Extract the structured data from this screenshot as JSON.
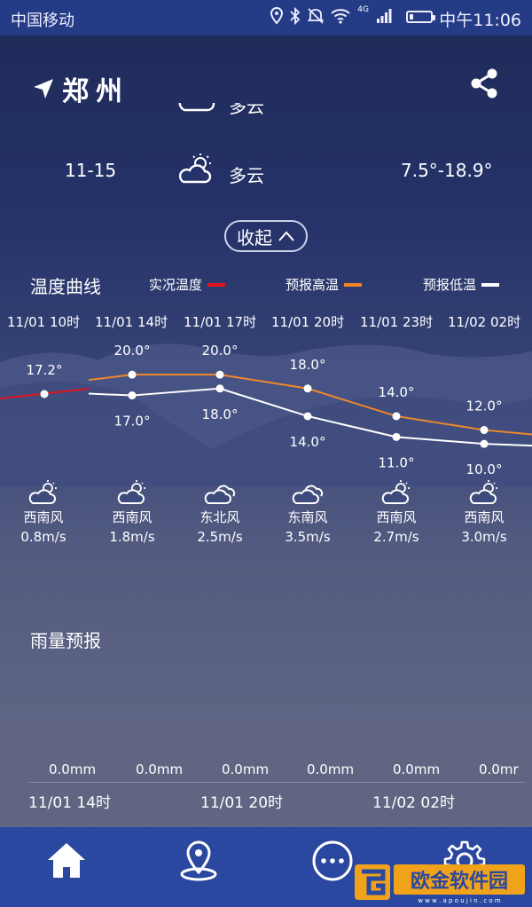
{
  "status_bar": {
    "carrier": "中国移动",
    "time": "中午11:06",
    "network": "4G",
    "icons": [
      "location-icon",
      "bluetooth-icon",
      "mute-icon",
      "wifi-icon",
      "signal-icon",
      "battery-icon"
    ],
    "battery_level": 0.2
  },
  "header": {
    "city": "郑州",
    "location_icon": "location-arrow-icon",
    "share_icon": "share-icon"
  },
  "daily": [
    {
      "date": "",
      "desc": "多云",
      "temp": "",
      "icon": "partly-cloudy-icon"
    },
    {
      "date": "11-15",
      "desc": "多云",
      "temp": "7.5°-18.9°",
      "icon": "partly-cloudy-icon"
    }
  ],
  "collapse_button": {
    "label": "收起",
    "icon": "chevron-up-icon"
  },
  "temp_section": {
    "title": "温度曲线",
    "legend": [
      {
        "label": "实况温度",
        "color": "#e0141e"
      },
      {
        "label": "预报高温",
        "color": "#f0882a"
      },
      {
        "label": "预报低温",
        "color": "#ffffff"
      }
    ]
  },
  "chart_data": {
    "type": "line",
    "x": [
      "11/01 10时",
      "11/01 14时",
      "11/01 17时",
      "11/01 20时",
      "11/01 23时",
      "11/02 02时"
    ],
    "series": [
      {
        "name": "实况温度",
        "values": [
          17.2,
          null,
          null,
          null,
          null,
          null
        ]
      },
      {
        "name": "预报高温",
        "values": [
          null,
          20.0,
          20.0,
          18.0,
          14.0,
          12.0
        ]
      },
      {
        "name": "预报低温",
        "values": [
          null,
          17.0,
          18.0,
          14.0,
          11.0,
          10.0
        ]
      }
    ],
    "labels": {
      "observed": [
        "17.2°"
      ],
      "high": [
        "20.0°",
        "20.0°",
        "18.0°",
        "14.0°",
        "12.0°"
      ],
      "low": [
        "17.0°",
        "18.0°",
        "14.0°",
        "11.0°",
        "10.0°"
      ]
    }
  },
  "wind": [
    {
      "icon": "partly-cloudy-icon",
      "direction": "西南风",
      "speed": "0.8m/s"
    },
    {
      "icon": "partly-cloudy-icon",
      "direction": "西南风",
      "speed": "1.8m/s"
    },
    {
      "icon": "cloudy-icon",
      "direction": "东北风",
      "speed": "2.5m/s"
    },
    {
      "icon": "cloudy-icon",
      "direction": "东南风",
      "speed": "3.5m/s"
    },
    {
      "icon": "partly-cloudy-icon",
      "direction": "西南风",
      "speed": "2.7m/s"
    },
    {
      "icon": "partly-cloudy-icon",
      "direction": "西南风",
      "speed": "3.0m/s"
    }
  ],
  "rain": {
    "title": "雨量预报",
    "values": [
      "0.0mm",
      "0.0mm",
      "0.0mm",
      "0.0mm",
      "0.0mm",
      "0.0mr"
    ],
    "times": [
      "11/01 14时",
      "11/01 20时",
      "11/02 02时"
    ]
  },
  "bottom_nav": [
    {
      "name": "home",
      "icon": "home-icon"
    },
    {
      "name": "map",
      "icon": "map-pin-icon"
    },
    {
      "name": "more",
      "icon": "more-icon"
    },
    {
      "name": "settings",
      "icon": "gear-icon"
    }
  ],
  "watermark": {
    "text": "欧金软件园",
    "url_text": "w w w . a p o u j i n . c o m"
  }
}
